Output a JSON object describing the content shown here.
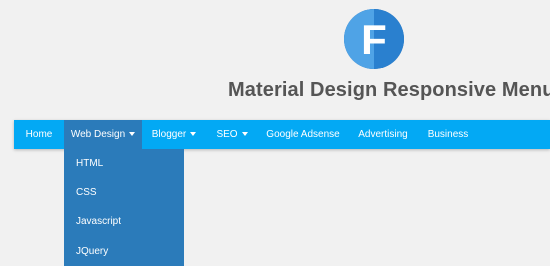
{
  "header": {
    "title": "Material Design Responsive Menu",
    "logo": {
      "icon": "letter-f-logo-icon",
      "letter": "F",
      "colors": {
        "circle_light": "#4fa3e6",
        "circle_dark": "#1d5fa6",
        "letter": "#ffffff"
      }
    }
  },
  "nav": {
    "items": [
      {
        "label": "Home",
        "has_dropdown": false,
        "active": false
      },
      {
        "label": "Web Design",
        "has_dropdown": true,
        "active": true
      },
      {
        "label": "Blogger",
        "has_dropdown": true,
        "active": false
      },
      {
        "label": "SEO",
        "has_dropdown": true,
        "active": false
      },
      {
        "label": "Google Adsense",
        "has_dropdown": false,
        "active": false
      },
      {
        "label": "Advertising",
        "has_dropdown": false,
        "active": false
      },
      {
        "label": "Business",
        "has_dropdown": false,
        "active": false
      }
    ]
  },
  "dropdown": {
    "parent": "Web Design",
    "items": [
      {
        "label": "HTML"
      },
      {
        "label": "CSS"
      },
      {
        "label": "Javascript"
      },
      {
        "label": "JQuery"
      }
    ]
  },
  "colors": {
    "background": "#f1f1f1",
    "navbar": "#03a9f4",
    "active": "#2b7bba",
    "title": "#555555"
  }
}
